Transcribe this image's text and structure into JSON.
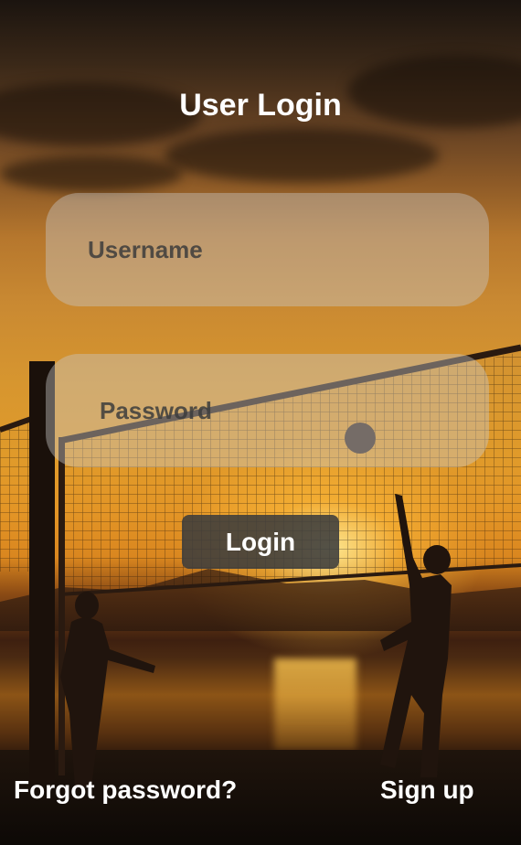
{
  "page": {
    "title": "User Login"
  },
  "form": {
    "username_placeholder": "Username",
    "password_placeholder": "Password",
    "login_label": "Login"
  },
  "links": {
    "forgot_password": "Forgot password?",
    "sign_up": "Sign up"
  },
  "background": {
    "scene": "sunset-beach-volleyball-photo",
    "colors": [
      "#1b140f",
      "#c98932",
      "#e39526",
      "#0c0805"
    ]
  }
}
